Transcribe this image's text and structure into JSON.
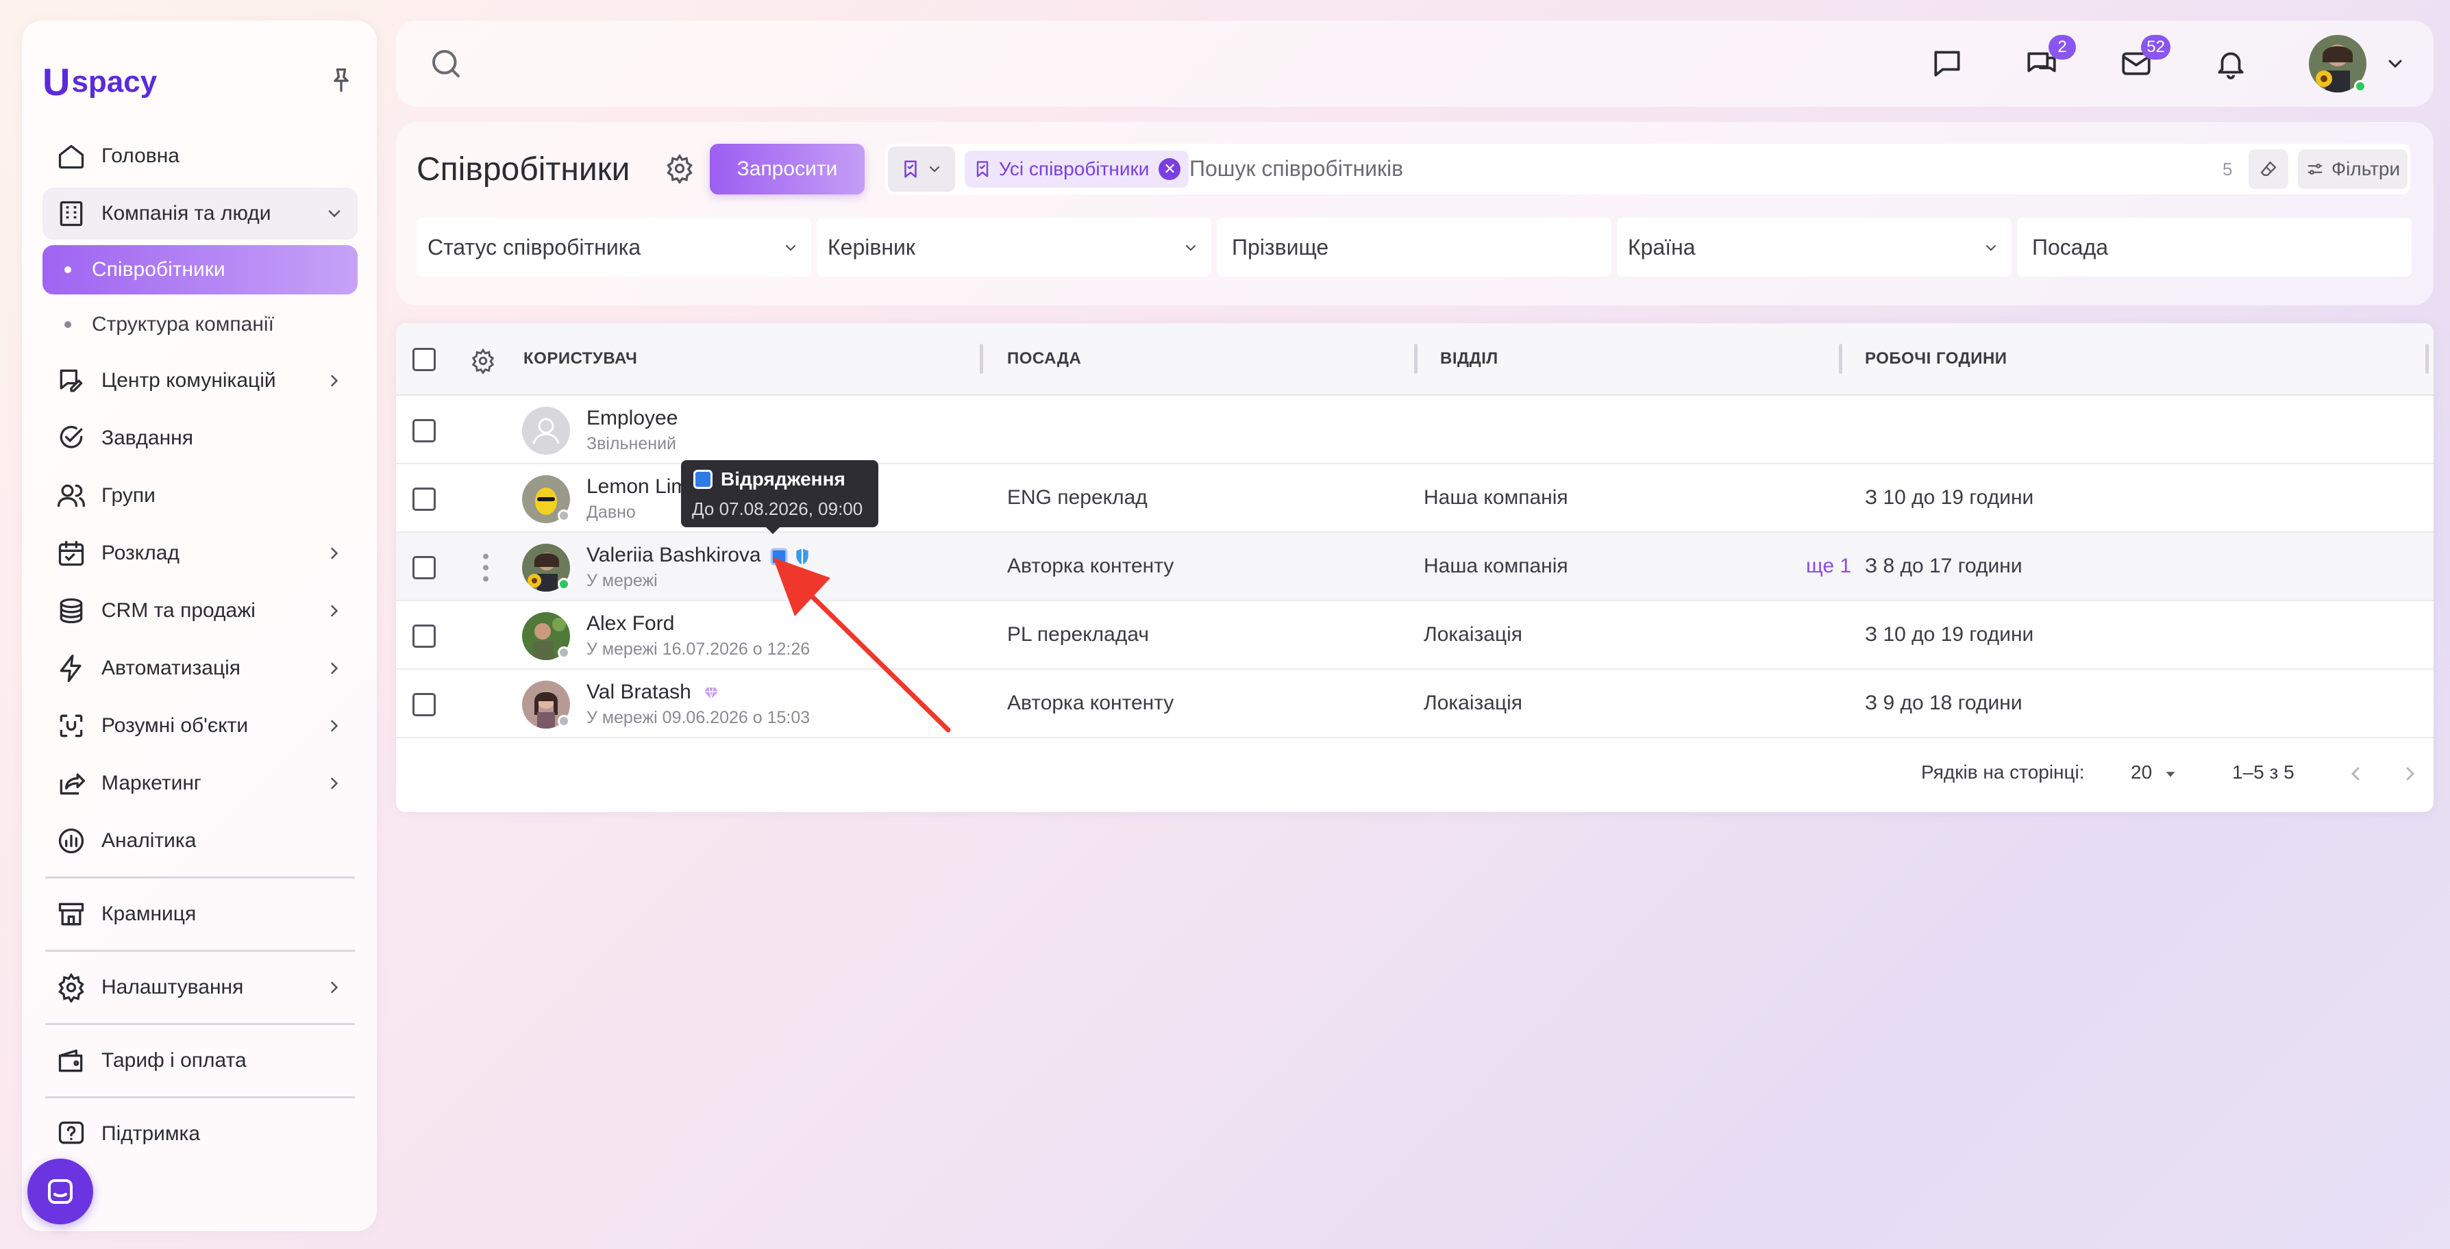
{
  "brand": {
    "logo_mark": "U",
    "logo_text": "spacy"
  },
  "sidebar": {
    "items": [
      {
        "label": "Головна",
        "icon": "home-icon"
      },
      {
        "label": "Компанія та люди",
        "icon": "building-icon",
        "expanded": true,
        "children": [
          {
            "label": "Співробітники",
            "active": true
          },
          {
            "label": "Структура компанії"
          }
        ]
      },
      {
        "label": "Центр комунікацій",
        "icon": "chat-edit-icon"
      },
      {
        "label": "Завдання",
        "icon": "check-circle-icon"
      },
      {
        "label": "Групи",
        "icon": "users-icon"
      },
      {
        "label": "Розклад",
        "icon": "calendar-icon"
      },
      {
        "label": "CRM та продажі",
        "icon": "coins-icon"
      },
      {
        "label": "Автоматизація",
        "icon": "bolt-icon"
      },
      {
        "label": "Розумні об'єкти",
        "icon": "smart-object-icon"
      },
      {
        "label": "Маркетинг",
        "icon": "share-icon"
      },
      {
        "label": "Аналітика",
        "icon": "chart-icon"
      },
      {
        "label": "Крамниця",
        "icon": "store-icon"
      },
      {
        "label": "Налаштування",
        "icon": "gear-icon"
      },
      {
        "label": "Тариф і оплата",
        "icon": "wallet-icon"
      },
      {
        "label": "Підтримка",
        "icon": "help-icon"
      }
    ]
  },
  "topbar": {
    "chat_badge": "2",
    "mail_badge": "52"
  },
  "page": {
    "title": "Співробітники",
    "invite_label": "Запросити",
    "chip_label": "Усі співробітники",
    "search_placeholder": "Пошук співробітників",
    "count": "5",
    "filters_label": "Фільтри",
    "filter_fields": [
      "Статус співробітника",
      "Керівник",
      "Прізвище",
      "Країна",
      "Посада"
    ]
  },
  "table": {
    "headers": [
      "КОРИСТУВАЧ",
      "ПОСАДА",
      "ВІДДІЛ",
      "РОБОЧІ ГОДИНИ"
    ],
    "rows": [
      {
        "name": "Employee",
        "status": "Звільнений",
        "position": "",
        "department": "",
        "hours": ""
      },
      {
        "name": "Lemon Lim",
        "status": "Давно",
        "position": "ENG переклад",
        "department": "Наша компанія",
        "hours": "З 10 до 19 години"
      },
      {
        "name": "Valeriia Bashkirova",
        "status": "У мережі",
        "position": "Авторка контенту",
        "department": "Наша компанія",
        "extra": "ще 1",
        "hours": "З 8 до 17 години"
      },
      {
        "name": "Alex Ford",
        "status": "У мережі 16.07.2026 о 12:26",
        "position": "PL перекладач",
        "department": "Локаізація",
        "hours": "З 10 до 19 години"
      },
      {
        "name": "Val Bratash",
        "status": "У мережі 09.06.2026 о 15:03",
        "position": "Авторка контенту",
        "department": "Локаізація",
        "hours": "З 9 до 18 години"
      }
    ],
    "rows_per_page_label": "Рядків на сторінці:",
    "rows_per_page": "20",
    "range": "1–5 з 5"
  },
  "tooltip": {
    "title": "Відрядження",
    "subtitle": "До 07.08.2026, 09:00"
  },
  "colors": {
    "accent": "#9d5ef2",
    "brand": "#5b2bd9",
    "online": "#2fc65d",
    "arrow": "#f0372c"
  }
}
